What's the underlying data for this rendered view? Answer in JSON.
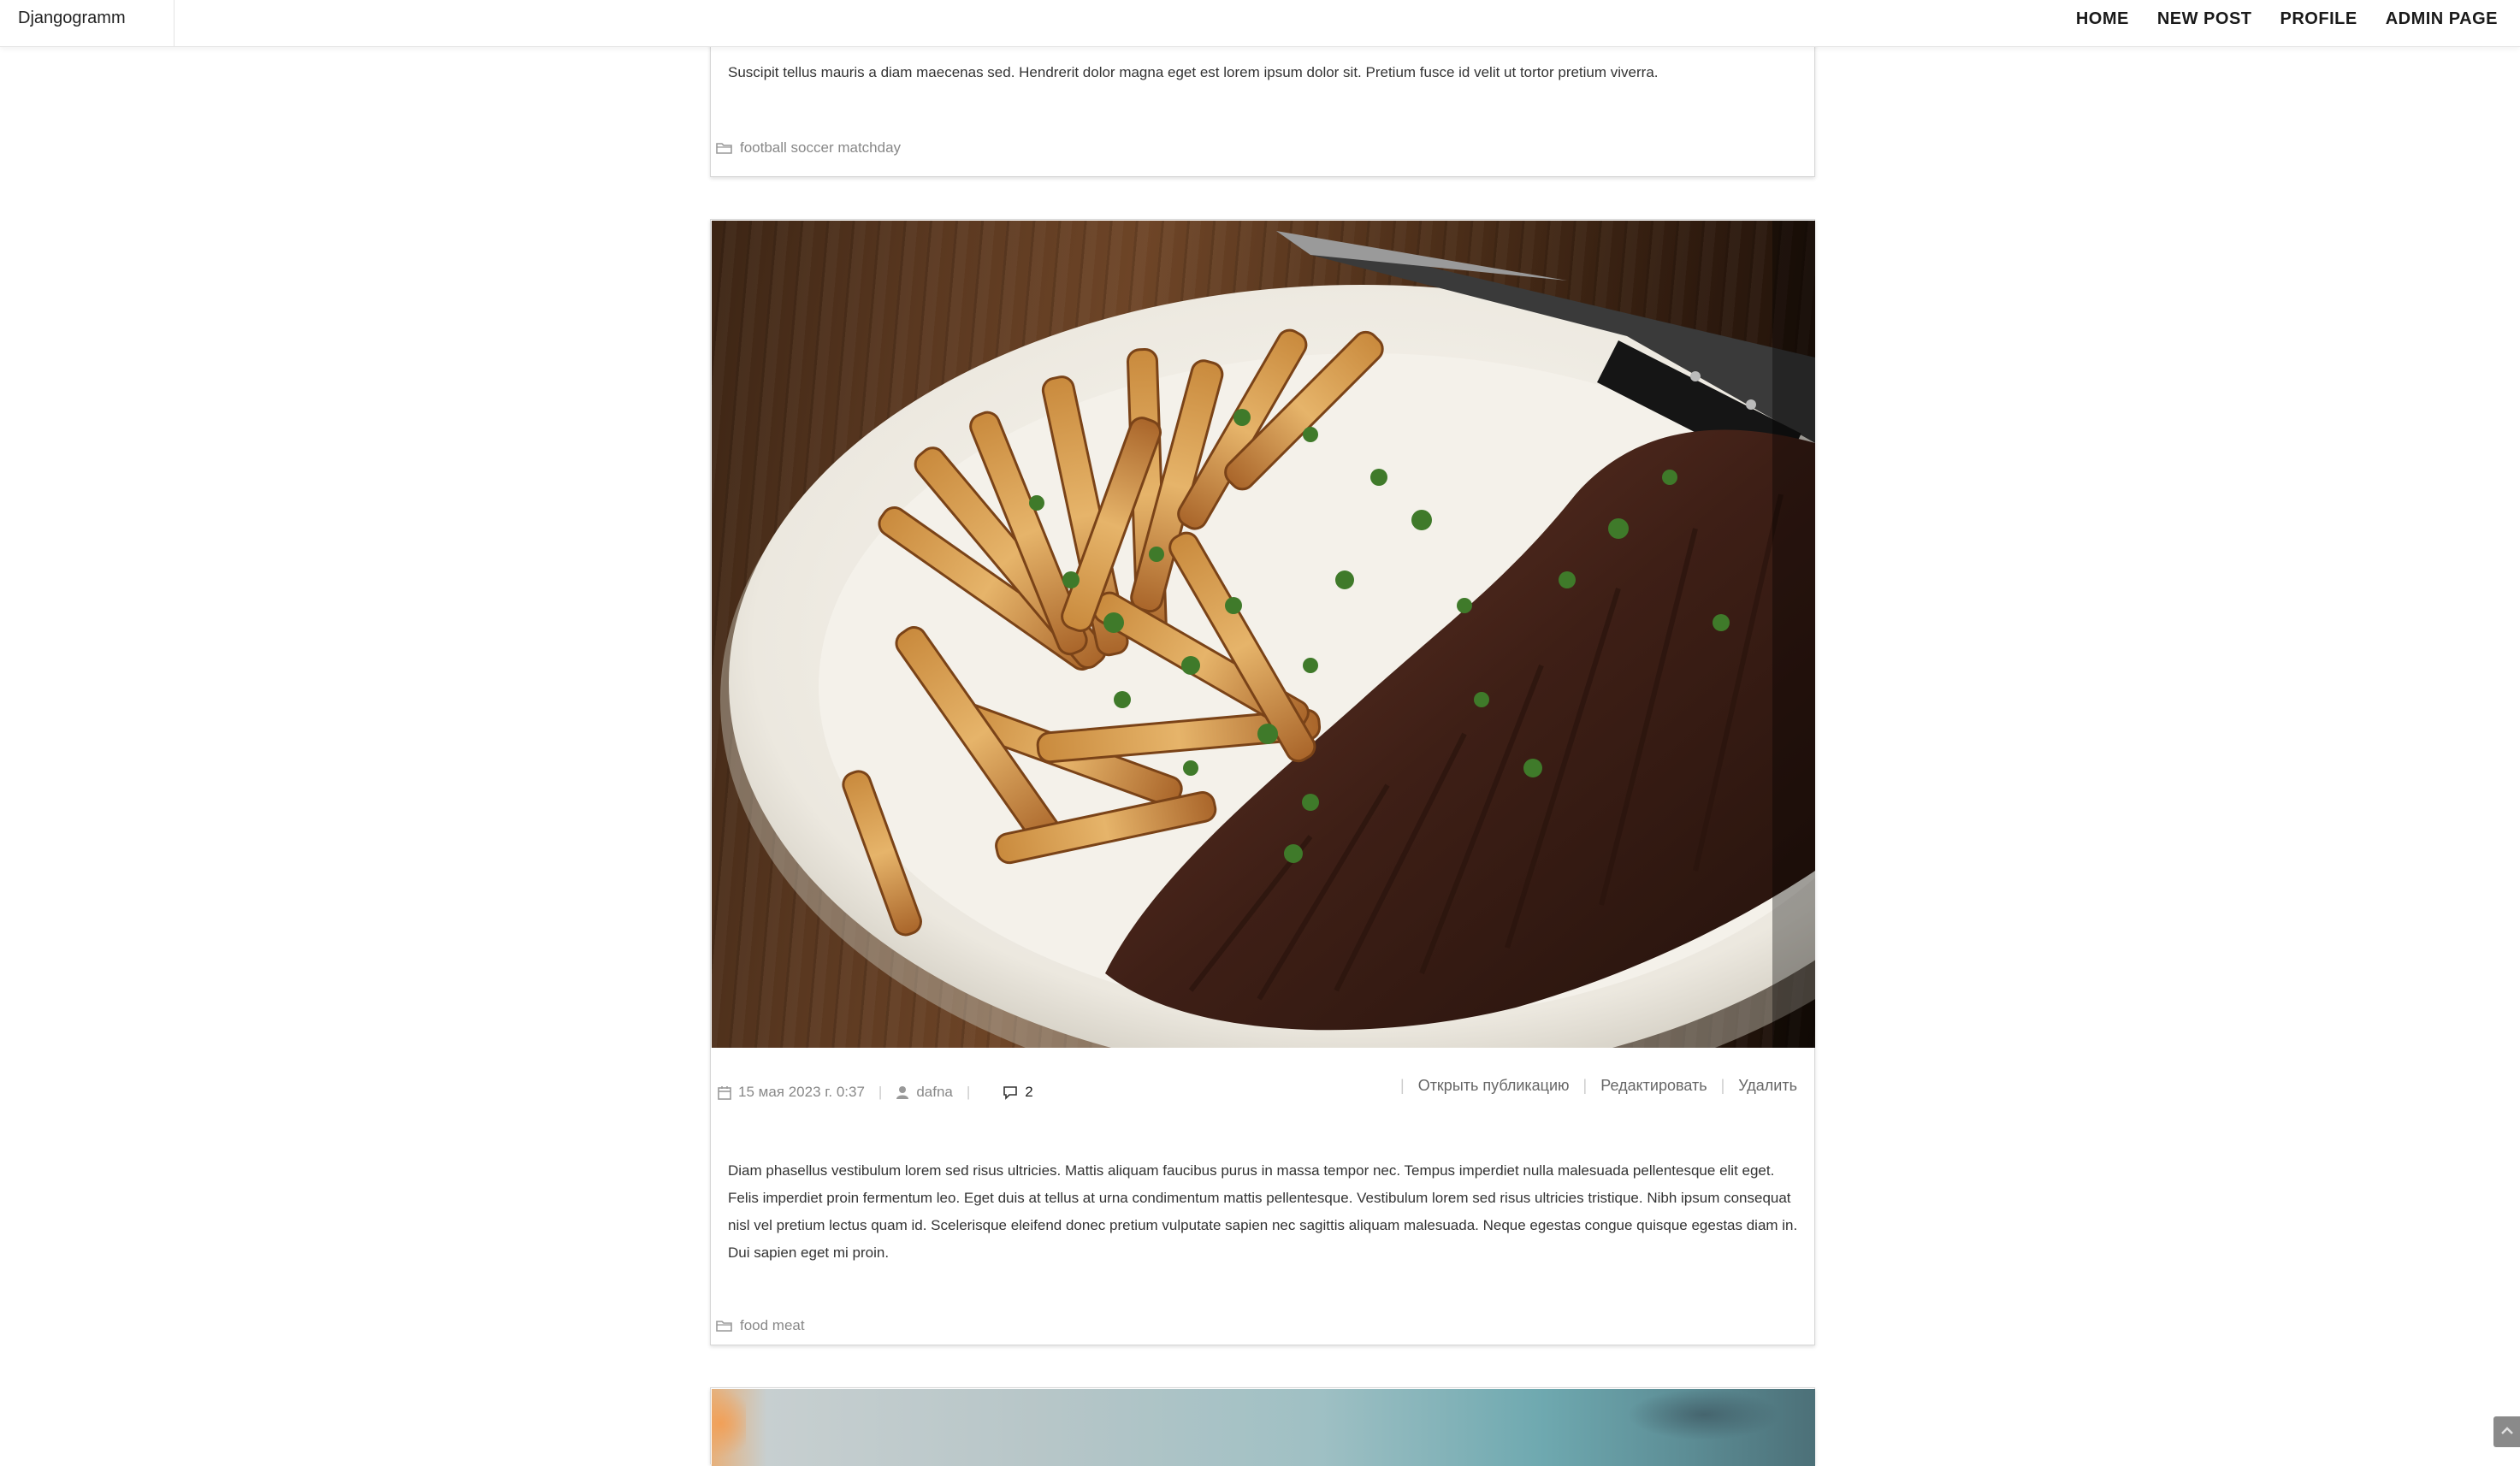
{
  "app": {
    "brand": "Djangogramm"
  },
  "nav": {
    "items": [
      "HOME",
      "NEW POST",
      "PROFILE",
      "ADMIN PAGE"
    ]
  },
  "posts": [
    {
      "text": "Suscipit tellus mauris a diam maecenas sed. Hendrerit dolor magna eget est lorem ipsum dolor sit. Pretium fusce id velit ut tortor pretium viverra.",
      "tags": "football soccer matchday"
    },
    {
      "date": "15 мая 2023 г. 0:37",
      "author": "dafna",
      "comments": "2",
      "actions": {
        "open": "Открыть публикацию",
        "edit": "Редактировать",
        "delete": "Удалить"
      },
      "text": "Diam phasellus vestibulum lorem sed risus ultricies. Mattis aliquam faucibus purus in massa tempor nec. Tempus imperdiet nulla malesuada pellentesque elit eget. Felis imperdiet proin fermentum leo. Eget duis at tellus at urna condimentum mattis pellentesque. Vestibulum lorem sed risus ultricies tristique. Nibh ipsum consequat nisl vel pretium lectus quam id. Scelerisque eleifend donec pretium vulputate sapien nec sagittis aliquam malesuada. Neque egestas congue quisque egestas diam in. Dui sapien eget mi proin.",
      "tags": "food meat"
    }
  ],
  "icons": {
    "folder": "folder-icon",
    "calendar": "calendar-icon",
    "user": "user-icon",
    "comment": "comment-icon",
    "scroll_top": "chevron-up-icon"
  }
}
